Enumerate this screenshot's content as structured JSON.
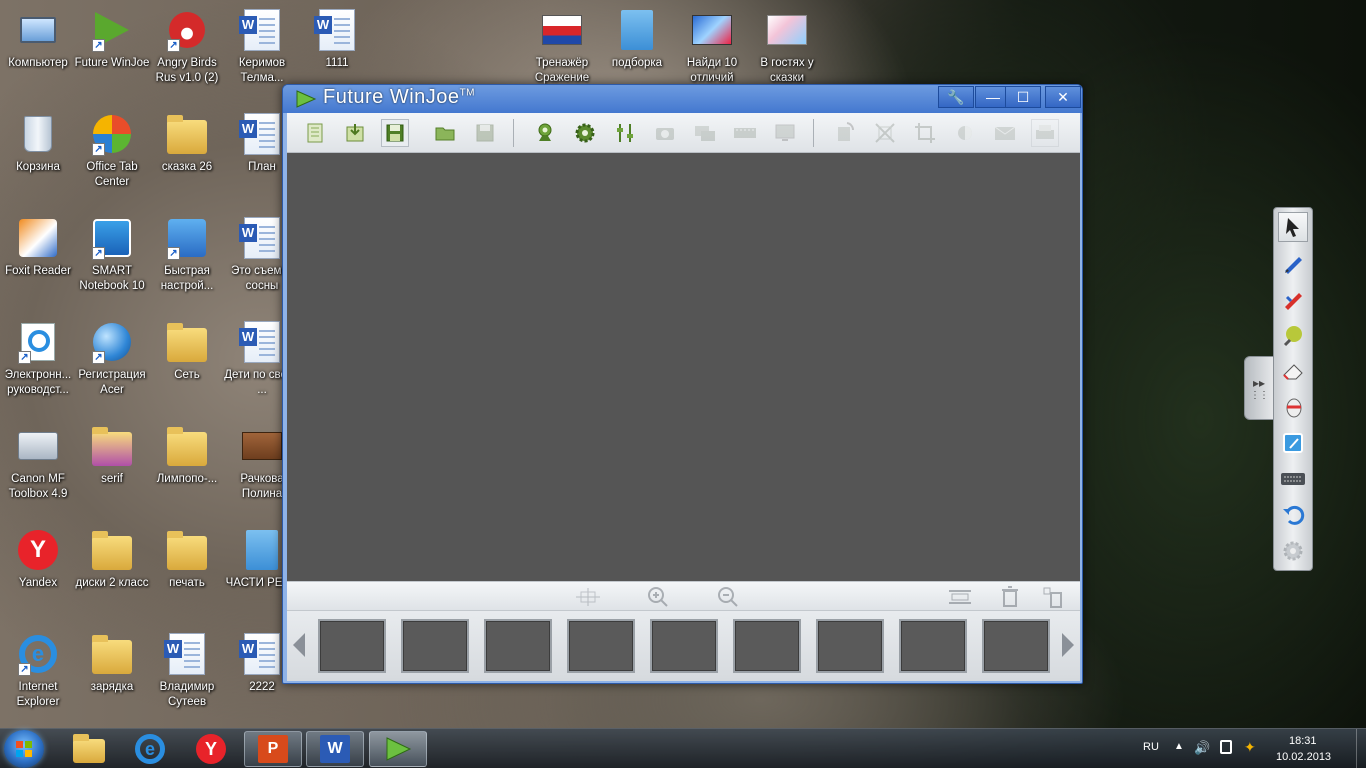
{
  "desktop": {
    "icons": [
      {
        "label": "Компьютер",
        "icon": "computer-icon"
      },
      {
        "label": "Future WinJoe",
        "icon": "winjoe-shortcut-icon"
      },
      {
        "label": "Angry Birds Rus v1.0 (2)",
        "icon": "angry-birds-icon"
      },
      {
        "label": "Керимов Телма...",
        "icon": "word-doc-icon"
      },
      {
        "label": "1111",
        "icon": "word-doc-icon"
      },
      {
        "label": "Тренажёр Сражение",
        "icon": "presentation-icon"
      },
      {
        "label": "подборка",
        "icon": "text-doc-icon"
      },
      {
        "label": "Найди 10 отличий",
        "icon": "picture-icon"
      },
      {
        "label": "В гостях у сказки",
        "icon": "picture-icon"
      },
      {
        "label": "Корзина",
        "icon": "recycle-bin-icon"
      },
      {
        "label": "Office Tab Center",
        "icon": "office-tab-icon"
      },
      {
        "label": "сказка 26",
        "icon": "folder-icon"
      },
      {
        "label": "План",
        "icon": "word-doc-icon"
      },
      {
        "label": "Foxit Reader",
        "icon": "foxit-icon"
      },
      {
        "label": "SMART Notebook 10",
        "icon": "smart-notebook-icon"
      },
      {
        "label": "Быстрая настрой...",
        "icon": "quick-setup-icon"
      },
      {
        "label": "Это съемки сосны",
        "icon": "word-doc-icon"
      },
      {
        "label": "Электронн... руководст...",
        "icon": "ie-doc-icon"
      },
      {
        "label": "Регистрация Acer",
        "icon": "acer-globe-icon"
      },
      {
        "label": "Сеть",
        "icon": "folder-icon"
      },
      {
        "label": "Дети по своей ...",
        "icon": "word-doc-icon"
      },
      {
        "label": "Canon MF Toolbox 4.9",
        "icon": "canon-icon"
      },
      {
        "label": "serif",
        "icon": "folder-icon"
      },
      {
        "label": "Лимпопо-...",
        "icon": "folder-icon"
      },
      {
        "label": "Рачкова Полина",
        "icon": "presentation-icon"
      },
      {
        "label": "Yandex",
        "icon": "yandex-icon"
      },
      {
        "label": "диски 2 класс",
        "icon": "folder-icon"
      },
      {
        "label": "печать",
        "icon": "folder-icon"
      },
      {
        "label": "ЧАСТИ РЕЧИ",
        "icon": "text-doc-icon"
      },
      {
        "label": "Internet Explorer",
        "icon": "ie-icon"
      },
      {
        "label": "зарядка",
        "icon": "folder-icon"
      },
      {
        "label": "Владимир Сутеев",
        "icon": "word-doc-icon"
      },
      {
        "label": "2222",
        "icon": "word-doc-icon"
      }
    ]
  },
  "window": {
    "title": "Future WinJoe",
    "trademark": "TM",
    "controls": {
      "settings": "🔧",
      "minimize": "—",
      "maximize": "☐",
      "close": "✕"
    }
  },
  "taskbar": {
    "language": "RU",
    "time": "18:31",
    "date": "10.02.2013"
  },
  "colors": {
    "canvas": "#555555",
    "titlebar": "#4a7fd4",
    "toolbar_green": "#5b8a2e"
  }
}
